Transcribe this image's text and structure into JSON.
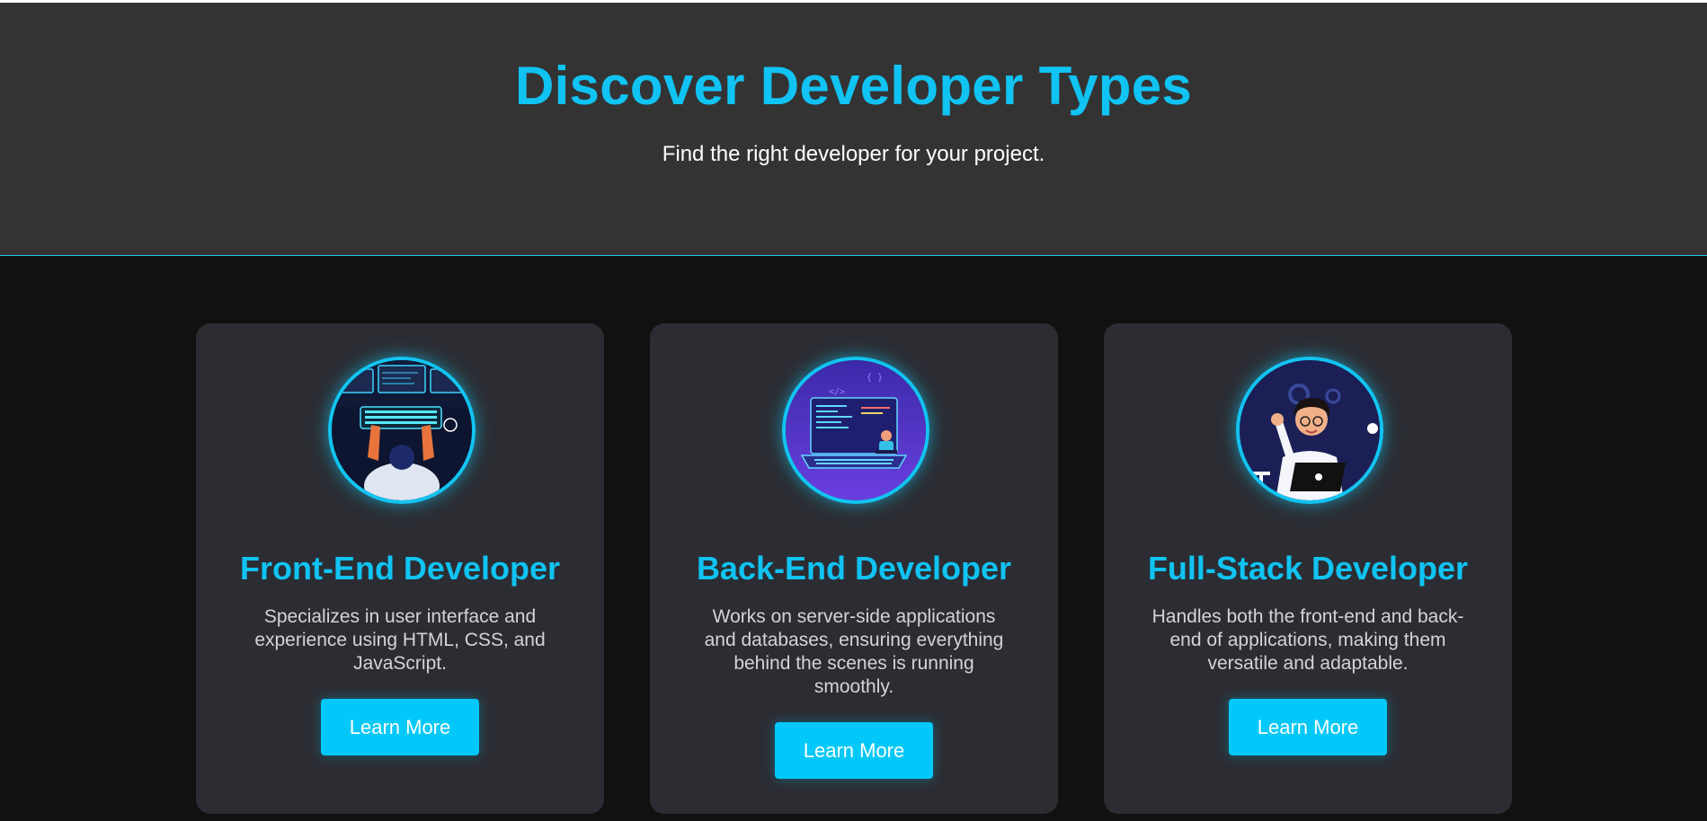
{
  "hero": {
    "title": "Discover Developer Types",
    "subtitle": "Find the right developer for your project."
  },
  "cards": [
    {
      "icon": "front-end-developer-illustration",
      "title": "Front-End Developer",
      "description": "Specializes in user interface and experience using HTML, CSS, and JavaScript.",
      "button": "Learn More"
    },
    {
      "icon": "back-end-developer-illustration",
      "title": "Back-End Developer",
      "description": "Works on server-side applications and databases, ensuring everything behind the scenes is running smoothly.",
      "button": "Learn More"
    },
    {
      "icon": "full-stack-developer-illustration",
      "title": "Full-Stack Developer",
      "description": "Handles both the front-end and back-end of applications, making them versatile and adaptable.",
      "button": "Learn More"
    }
  ],
  "colors": {
    "accent": "#10c3f3",
    "button": "#00c8fa",
    "card_bg": "#2b2d33",
    "hero_bg": "#333333",
    "page_bg": "#111111"
  }
}
